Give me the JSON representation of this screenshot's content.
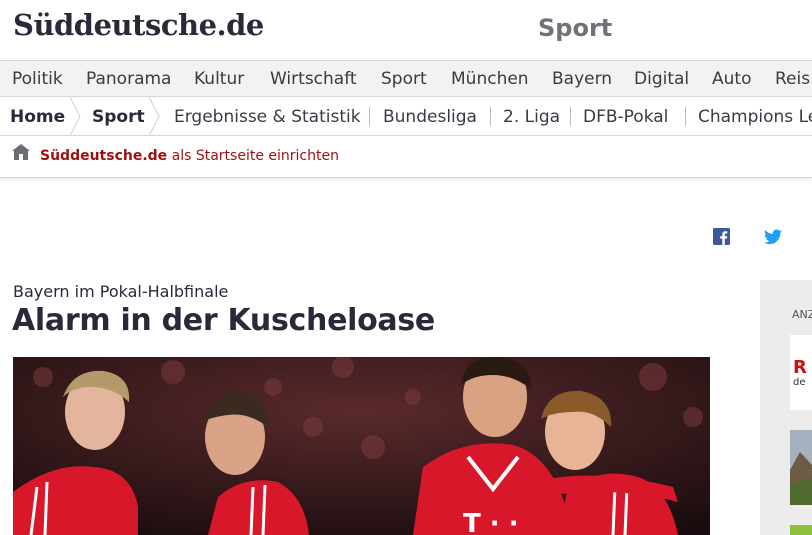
{
  "masthead": {
    "logo": "Süddeutsche.de",
    "section": "Sport"
  },
  "nav_main": {
    "items": [
      "Politik",
      "Panorama",
      "Kultur",
      "Wirtschaft",
      "Sport",
      "München",
      "Bayern",
      "Digital",
      "Auto",
      "Reis"
    ]
  },
  "nav_sub": {
    "breadcrumb": [
      "Home",
      "Sport"
    ],
    "items": [
      "Ergebnisse & Statistik",
      "Bundesliga",
      "2. Liga",
      "DFB-Pokal",
      "Champions Le"
    ]
  },
  "startbar": {
    "link_brand": "Süddeutsche.de",
    "link_rest": " als Startseite einrichten",
    "icon": "home-icon"
  },
  "social": {
    "facebook_icon": "facebook-icon",
    "twitter_icon": "twitter-icon",
    "facebook_color": "#3b5998",
    "twitter_color": "#1da1f2"
  },
  "article": {
    "kicker": "Bayern im Pokal-Halbfinale",
    "headline": "Alarm in der Kuscheloase"
  },
  "sidebar": {
    "ad_label": "ANZ",
    "ad_text": "R",
    "ad_subtext": "de"
  },
  "colors": {
    "brand_dark": "#29293a",
    "link_red": "#9e1010",
    "nav_bg": "#f2f2f2"
  }
}
